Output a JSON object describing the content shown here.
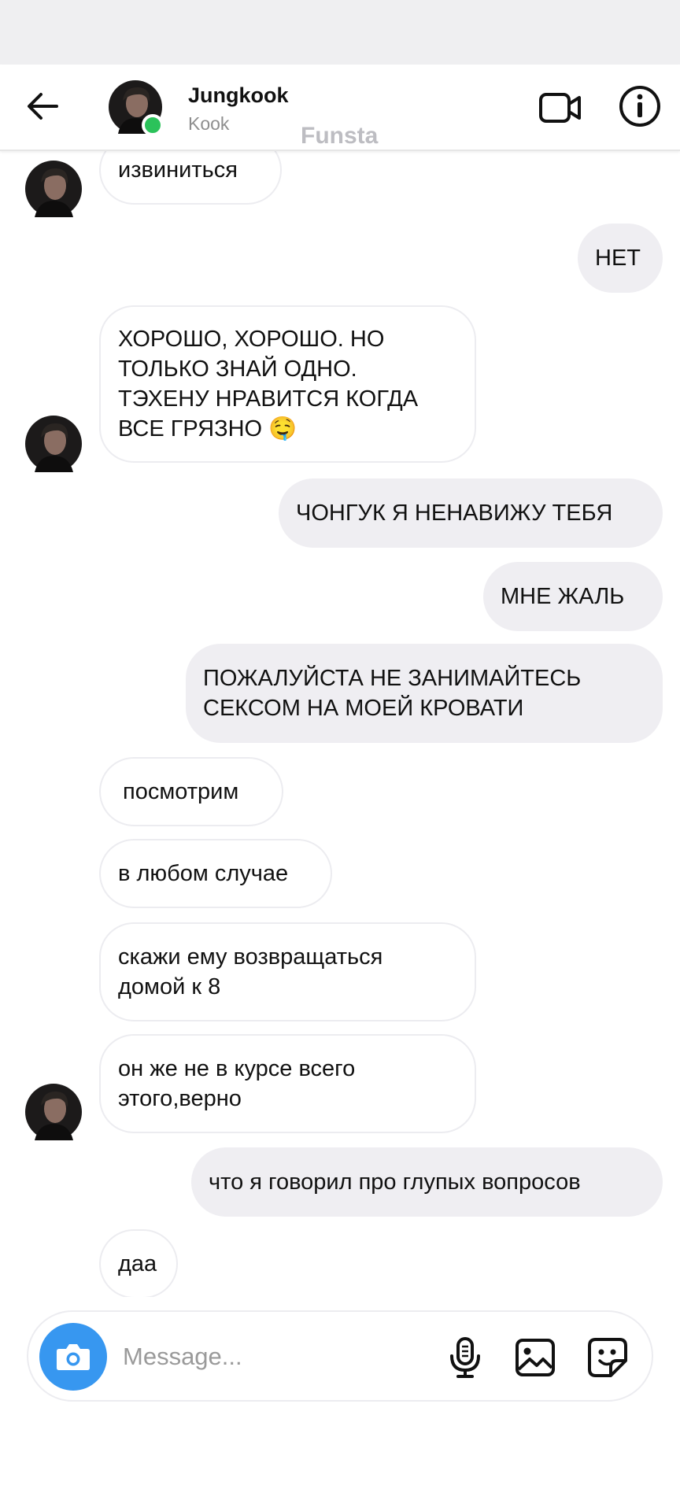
{
  "header": {
    "name": "Jungkook",
    "username": "Kook",
    "watermark": "Funsta"
  },
  "icons": {
    "back": "arrow-left-icon",
    "video": "video-camera-icon",
    "info": "info-icon",
    "camera": "camera-icon",
    "mic": "microphone-icon",
    "gallery": "image-icon",
    "sticker": "sticker-icon"
  },
  "colors": {
    "online": "#2bc25a",
    "camera_button": "#3797f0",
    "outgoing_bubble": "#efeef2",
    "incoming_border": "#ececf0"
  },
  "messages": [
    {
      "side": "in",
      "text": "извиниться"
    },
    {
      "side": "out",
      "text": "НЕТ"
    },
    {
      "side": "in",
      "text": "ХОРОШО, ХОРОШО. НО\nТОЛЬКО ЗНАЙ ОДНО.\nТЭХЕНУ НРАВИТСЯ КОГДА\nВСЕ ГРЯЗНО 🤤"
    },
    {
      "side": "out",
      "text": "ЧОНГУК Я НЕНАВИЖУ ТЕБЯ"
    },
    {
      "side": "out",
      "text": "МНЕ ЖАЛЬ"
    },
    {
      "side": "out",
      "text": "ПОЖАЛУЙСТА НЕ ЗАНИМАЙТЕСЬ\nСЕКСОМ НА МОЕЙ КРОВАТИ"
    },
    {
      "side": "in",
      "text": "посмотрим"
    },
    {
      "side": "in",
      "text": "в любом случае"
    },
    {
      "side": "in",
      "text": "скажи ему возвращаться\nдомой к 8"
    },
    {
      "side": "in",
      "text": "он же не в курсе всего\nэтого,верно"
    },
    {
      "side": "out",
      "text": "что я говорил про глупых вопросов"
    },
    {
      "side": "in",
      "text": "даа"
    }
  ],
  "composer": {
    "placeholder": "Message..."
  }
}
